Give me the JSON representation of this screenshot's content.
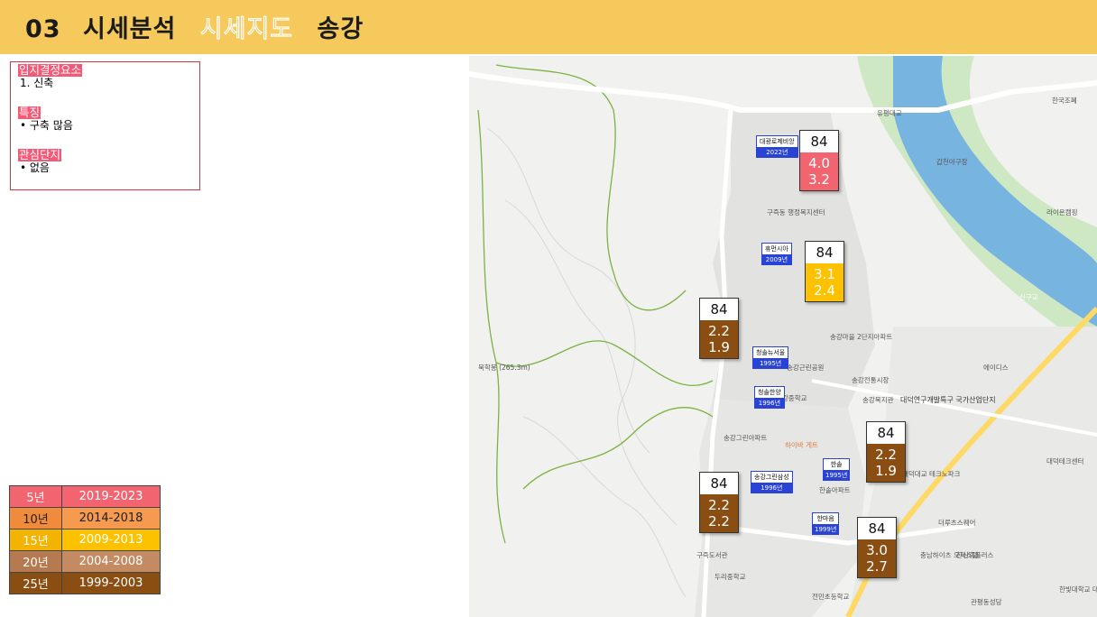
{
  "header": {
    "num": "03",
    "part1": "시세분석",
    "part2": "시세지도",
    "part3": "송강",
    "bg_color": "#f6c95c"
  },
  "info": {
    "section1_title": "입지결정요소",
    "section1_item": "1.  신축",
    "section2_title": "특징",
    "section2_item": "•  구축 많음",
    "section3_title": "관심단지",
    "section3_item": "•  없음"
  },
  "legend": [
    {
      "age": "5년",
      "years": "2019-2023",
      "color_a": "#f26570",
      "color_b": "#f26570"
    },
    {
      "age": "10년",
      "years": "2014-2018",
      "color_a": "#f08a3d",
      "color_b": "#f59a4e"
    },
    {
      "age": "15년",
      "years": "2009-2013",
      "color_a": "#f2b400",
      "color_b": "#fcc200"
    },
    {
      "age": "20년",
      "years": "2004-2008",
      "color_a": "#b57a50",
      "color_b": "#c48a62"
    },
    {
      "age": "25년",
      "years": "1999-2003",
      "color_a": "#8b4e12",
      "color_b": "#8b4e12"
    }
  ],
  "map": {
    "place_labels": [
      {
        "text": "유평대교"
      },
      {
        "text": "갑천야구장"
      },
      {
        "text": "라이온캠핑"
      },
      {
        "text": "한국조폐"
      },
      {
        "text": "구즉동 행정복지센터"
      },
      {
        "text": "송강마을 2단지아파트"
      },
      {
        "text": "송강근린공원"
      },
      {
        "text": "송강전통시장"
      },
      {
        "text": "송강복지관"
      },
      {
        "text": "대덕연구개발특구 국가산업단지"
      },
      {
        "text": "송강그린아파트"
      },
      {
        "text": "하이바 게트"
      },
      {
        "text": "구즉도서관"
      },
      {
        "text": "두리중학교"
      },
      {
        "text": "한솔아파트"
      },
      {
        "text": "더루츠스퀘어"
      },
      {
        "text": "충남하이츠 오피스텔"
      },
      {
        "text": "한신휴플러스"
      },
      {
        "text": "관평동성당"
      },
      {
        "text": "북학봉 (265.3m)"
      },
      {
        "text": "신구교"
      },
      {
        "text": "에이디스"
      },
      {
        "text": "대덕테크센터"
      },
      {
        "text": "한빛대학교 대덕중앙"
      },
      {
        "text": "송강중학교"
      },
      {
        "text": "전민초등학교"
      },
      {
        "text": "대덕대교 테크노파크"
      }
    ],
    "pins": [
      {
        "name": "대광로제비앙",
        "year": "2022년"
      },
      {
        "name": "휴먼시아",
        "year": "2009년"
      },
      {
        "name": "청솔뉴서울",
        "year": "1995년"
      },
      {
        "name": "청솔한양",
        "year": "1996년"
      },
      {
        "name": "송강그린삼성",
        "year": "1996년"
      },
      {
        "name": "한솔",
        "year": "1995년"
      },
      {
        "name": "한마음",
        "year": "1999년"
      }
    ],
    "price_boxes": [
      {
        "size": "84",
        "v1": "4.0",
        "v2": "3.2",
        "color": "#f26570"
      },
      {
        "size": "84",
        "v1": "3.1",
        "v2": "2.4",
        "color": "#fcc200"
      },
      {
        "size": "84",
        "v1": "2.2",
        "v2": "1.9",
        "color": "#8b4e12"
      },
      {
        "size": "84",
        "v1": "2.2",
        "v2": "1.9",
        "color": "#8b4e12"
      },
      {
        "size": "84",
        "v1": "2.2",
        "v2": "2.2",
        "color": "#8b4e12"
      },
      {
        "size": "84",
        "v1": "3.0",
        "v2": "2.7",
        "color": "#8b4e12"
      }
    ]
  }
}
